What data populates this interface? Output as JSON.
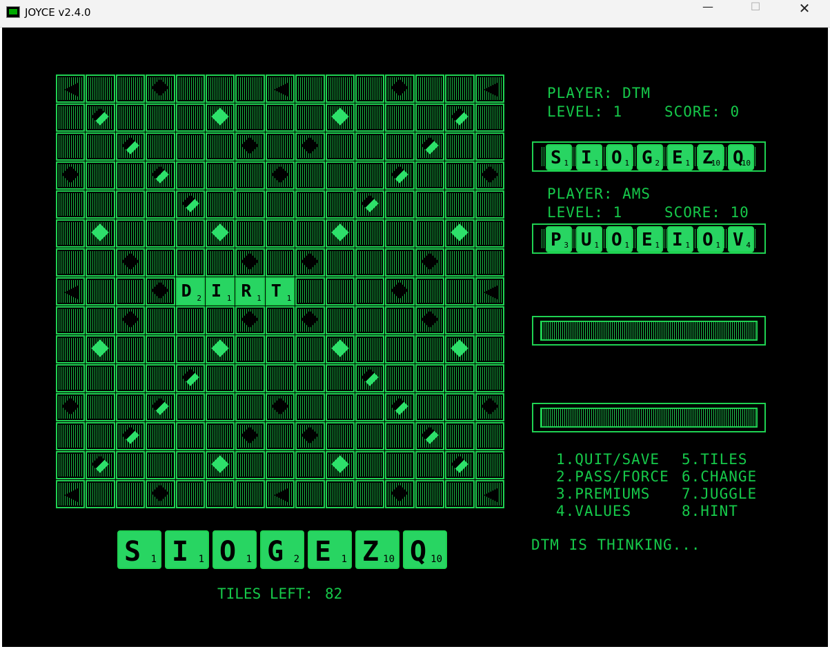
{
  "window": {
    "title": "JOYCE v2.4.0",
    "buttons": {
      "minimize": "—",
      "maximize": "☐",
      "close": "✕"
    }
  },
  "board": {
    "size": 15,
    "placed_tiles": [
      {
        "letter": "D",
        "score": "2",
        "row": 7,
        "col": 4
      },
      {
        "letter": "I",
        "score": "1",
        "row": 7,
        "col": 5
      },
      {
        "letter": "R",
        "score": "1",
        "row": 7,
        "col": 6
      },
      {
        "letter": "T",
        "score": "1",
        "row": 7,
        "col": 7
      }
    ]
  },
  "main_rack": [
    {
      "letter": "S",
      "score": "1"
    },
    {
      "letter": "I",
      "score": "1"
    },
    {
      "letter": "O",
      "score": "1"
    },
    {
      "letter": "G",
      "score": "2"
    },
    {
      "letter": "E",
      "score": "1"
    },
    {
      "letter": "Z",
      "score": "10"
    },
    {
      "letter": "Q",
      "score": "10"
    }
  ],
  "tiles_left": {
    "label": "TILES LEFT:",
    "value": "82"
  },
  "players": [
    {
      "player_label": "PLAYER: DTM",
      "level_label": "LEVEL:  1",
      "score_label": "SCORE:   0",
      "rack": [
        {
          "letter": "S",
          "score": "1"
        },
        {
          "letter": "I",
          "score": "1"
        },
        {
          "letter": "O",
          "score": "1"
        },
        {
          "letter": "G",
          "score": "2"
        },
        {
          "letter": "E",
          "score": "1"
        },
        {
          "letter": "Z",
          "score": "10"
        },
        {
          "letter": "Q",
          "score": "10"
        }
      ]
    },
    {
      "player_label": "PLAYER: AMS",
      "level_label": "LEVEL:  1",
      "score_label": "SCORE:  10",
      "rack": [
        {
          "letter": "P",
          "score": "3"
        },
        {
          "letter": "U",
          "score": "1"
        },
        {
          "letter": "O",
          "score": "1"
        },
        {
          "letter": "E",
          "score": "1"
        },
        {
          "letter": "I",
          "score": "1"
        },
        {
          "letter": "O",
          "score": "1"
        },
        {
          "letter": "V",
          "score": "4"
        }
      ]
    }
  ],
  "menu": [
    "1.QUIT/SAVE",
    "2.PASS/FORCE",
    "3.PREMIUMS",
    "4.VALUES",
    "5.TILES",
    "6.CHANGE",
    "7.JUGGLE",
    "8.HINT"
  ],
  "status": "DTM IS THINKING...",
  "colors": {
    "green": "#1fd252",
    "bright_green": "#2de16a",
    "background": "#000000"
  }
}
